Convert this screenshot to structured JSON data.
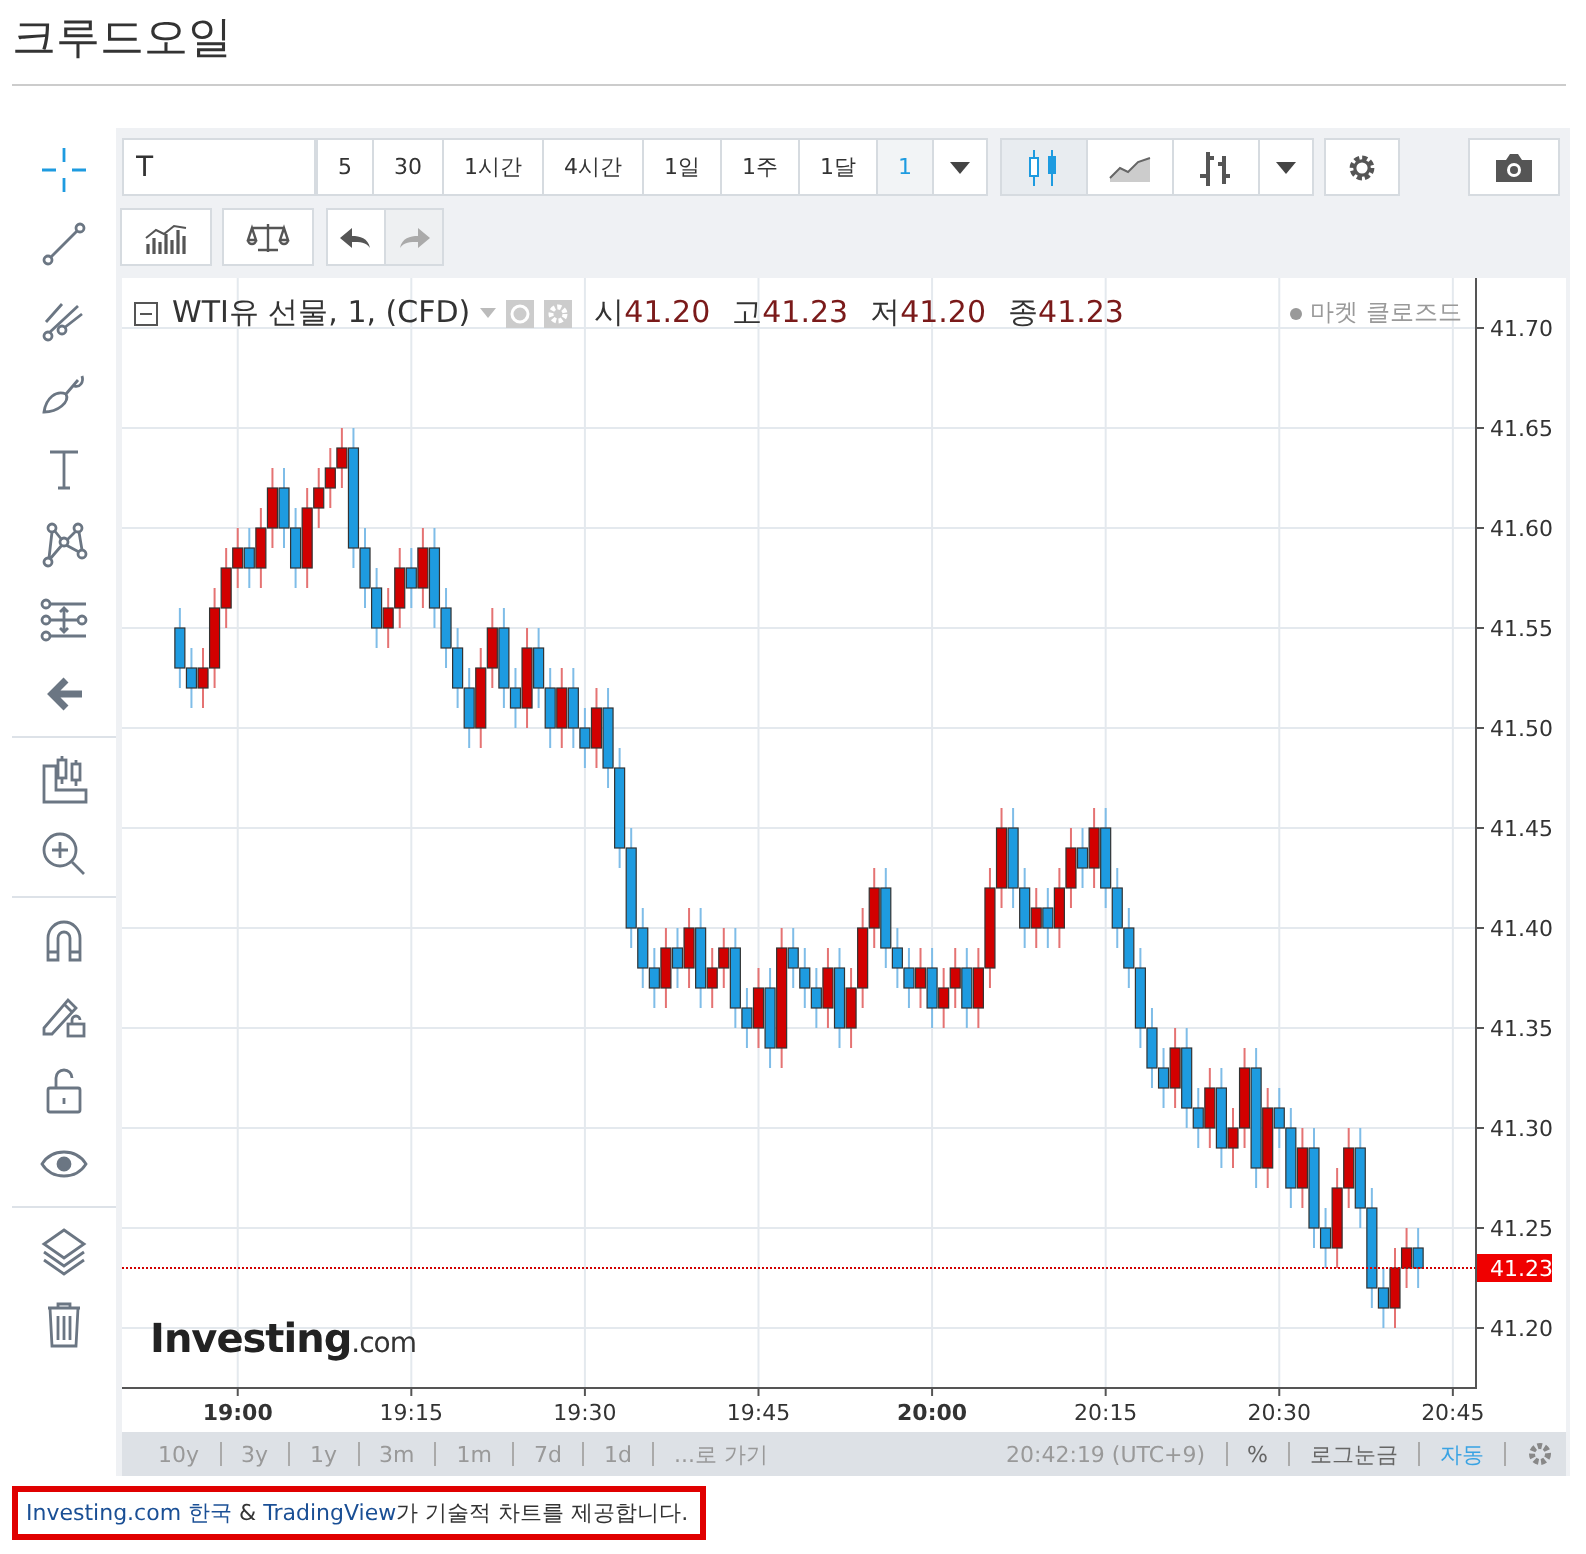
{
  "page_title": "크루드오일",
  "sidebar": {
    "groups": [
      [
        {
          "kind": "crosshair",
          "selected": true
        },
        {
          "kind": "trend-line",
          "selected": false
        },
        {
          "kind": "fork",
          "selected": false
        },
        {
          "kind": "brush",
          "selected": false
        },
        {
          "kind": "text",
          "selected": false
        },
        {
          "kind": "pattern",
          "selected": false
        },
        {
          "kind": "measure",
          "selected": false
        },
        {
          "kind": "back-arrow",
          "selected": false
        }
      ],
      [
        {
          "kind": "ruler",
          "selected": false
        },
        {
          "kind": "zoom",
          "selected": false
        }
      ],
      [
        {
          "kind": "magnet",
          "selected": false
        },
        {
          "kind": "pencil-lock",
          "selected": false
        },
        {
          "kind": "lock",
          "selected": false
        },
        {
          "kind": "eye",
          "selected": false
        }
      ],
      [
        {
          "kind": "layers",
          "selected": false
        },
        {
          "kind": "trash",
          "selected": false
        }
      ]
    ]
  },
  "toolbar": {
    "symbol": "T",
    "intervals": [
      {
        "label": "5",
        "selected": false
      },
      {
        "label": "30",
        "selected": false
      },
      {
        "label": "1시간",
        "selected": false
      },
      {
        "label": "4시간",
        "selected": false
      },
      {
        "label": "1일",
        "selected": false
      },
      {
        "label": "1주",
        "selected": false
      },
      {
        "label": "1달",
        "selected": false
      },
      {
        "label": "1",
        "selected": true
      }
    ],
    "chart_types": [
      {
        "kind": "candles",
        "selected": true
      },
      {
        "kind": "area",
        "selected": false
      },
      {
        "kind": "bars",
        "selected": false
      }
    ]
  },
  "legend": {
    "title": "WTI유 선물, 1, (CFD)",
    "values": [
      {
        "label": "시",
        "value": "41.20"
      },
      {
        "label": "고",
        "value": "41.23"
      },
      {
        "label": "저",
        "value": "41.20"
      },
      {
        "label": "종",
        "value": "41.23"
      }
    ],
    "status": "마켓 클로즈드"
  },
  "watermark_logo": {
    "main": "Investing",
    "suffix": ".com"
  },
  "chart_data": {
    "type": "candlestick",
    "grid": true,
    "ylim": [
      41.17,
      41.725
    ],
    "categories": [
      null,
      null,
      null,
      null,
      null,
      "19:00",
      null,
      null,
      null,
      null,
      null,
      null,
      null,
      null,
      null,
      null,
      null,
      null,
      null,
      null,
      "19:15",
      null,
      null,
      null,
      null,
      null,
      null,
      null,
      null,
      null,
      null,
      null,
      null,
      null,
      null,
      "19:30",
      null,
      null,
      null,
      null,
      null,
      null,
      null,
      null,
      null,
      null,
      null,
      null,
      null,
      null,
      "19:45",
      null,
      null,
      null,
      null,
      null,
      null,
      null,
      null,
      null,
      null,
      null,
      null,
      null,
      null,
      "20:00",
      null,
      null,
      null,
      null,
      null,
      null,
      null,
      null,
      null,
      null,
      null,
      null,
      null,
      null,
      "20:15",
      null,
      null,
      null,
      null,
      null,
      null,
      null,
      null,
      null,
      null,
      null,
      null,
      null,
      null,
      "20:30",
      null,
      null,
      null,
      null,
      null,
      null,
      null,
      null,
      null,
      null,
      null,
      null,
      null,
      null,
      "20:45"
    ],
    "yticks": [
      {
        "value": 41.2,
        "label": "41.20"
      },
      {
        "value": 41.25,
        "label": "41.25"
      },
      {
        "value": 41.3,
        "label": "41.30"
      },
      {
        "value": 41.35,
        "label": "41.35"
      },
      {
        "value": 41.4,
        "label": "41.40"
      },
      {
        "value": 41.45,
        "label": "41.45"
      },
      {
        "value": 41.5,
        "label": "41.50"
      },
      {
        "value": 41.55,
        "label": "41.55"
      },
      {
        "value": 41.6,
        "label": "41.60"
      },
      {
        "value": 41.65,
        "label": "41.65"
      },
      {
        "value": 41.7,
        "label": "41.70"
      }
    ],
    "ohlc": [
      [
        41.55,
        41.56,
        41.52,
        41.53
      ],
      [
        41.53,
        41.54,
        41.51,
        41.52
      ],
      [
        41.52,
        41.54,
        41.51,
        41.53
      ],
      [
        41.53,
        41.57,
        41.52,
        41.56
      ],
      [
        41.56,
        41.59,
        41.55,
        41.58
      ],
      [
        41.58,
        41.6,
        41.57,
        41.59
      ],
      [
        41.59,
        41.6,
        41.57,
        41.58
      ],
      [
        41.58,
        41.61,
        41.57,
        41.6
      ],
      [
        41.6,
        41.63,
        41.59,
        41.62
      ],
      [
        41.62,
        41.63,
        41.59,
        41.6
      ],
      [
        41.6,
        41.61,
        41.57,
        41.58
      ],
      [
        41.58,
        41.62,
        41.57,
        41.61
      ],
      [
        41.61,
        41.63,
        41.6,
        41.62
      ],
      [
        41.62,
        41.64,
        41.61,
        41.63
      ],
      [
        41.63,
        41.65,
        41.62,
        41.64
      ],
      [
        41.64,
        41.65,
        41.58,
        41.59
      ],
      [
        41.59,
        41.6,
        41.56,
        41.57
      ],
      [
        41.57,
        41.58,
        41.54,
        41.55
      ],
      [
        41.55,
        41.57,
        41.54,
        41.56
      ],
      [
        41.56,
        41.59,
        41.55,
        41.58
      ],
      [
        41.58,
        41.59,
        41.56,
        41.57
      ],
      [
        41.57,
        41.6,
        41.56,
        41.59
      ],
      [
        41.59,
        41.6,
        41.55,
        41.56
      ],
      [
        41.56,
        41.57,
        41.53,
        41.54
      ],
      [
        41.54,
        41.55,
        41.51,
        41.52
      ],
      [
        41.52,
        41.53,
        41.49,
        41.5
      ],
      [
        41.5,
        41.54,
        41.49,
        41.53
      ],
      [
        41.53,
        41.56,
        41.52,
        41.55
      ],
      [
        41.55,
        41.56,
        41.51,
        41.52
      ],
      [
        41.52,
        41.53,
        41.5,
        41.51
      ],
      [
        41.51,
        41.55,
        41.5,
        41.54
      ],
      [
        41.54,
        41.55,
        41.51,
        41.52
      ],
      [
        41.52,
        41.53,
        41.49,
        41.5
      ],
      [
        41.5,
        41.53,
        41.49,
        41.52
      ],
      [
        41.52,
        41.53,
        41.49,
        41.5
      ],
      [
        41.5,
        41.51,
        41.48,
        41.49
      ],
      [
        41.49,
        41.52,
        41.48,
        41.51
      ],
      [
        41.51,
        41.52,
        41.47,
        41.48
      ],
      [
        41.48,
        41.49,
        41.43,
        41.44
      ],
      [
        41.44,
        41.45,
        41.39,
        41.4
      ],
      [
        41.4,
        41.41,
        41.37,
        41.38
      ],
      [
        41.38,
        41.39,
        41.36,
        41.37
      ],
      [
        41.37,
        41.4,
        41.36,
        41.39
      ],
      [
        41.39,
        41.4,
        41.37,
        41.38
      ],
      [
        41.38,
        41.41,
        41.37,
        41.4
      ],
      [
        41.4,
        41.41,
        41.36,
        41.37
      ],
      [
        41.37,
        41.39,
        41.36,
        41.38
      ],
      [
        41.38,
        41.4,
        41.37,
        41.39
      ],
      [
        41.39,
        41.4,
        41.35,
        41.36
      ],
      [
        41.36,
        41.37,
        41.34,
        41.35
      ],
      [
        41.35,
        41.38,
        41.34,
        41.37
      ],
      [
        41.37,
        41.38,
        41.33,
        41.34
      ],
      [
        41.34,
        41.4,
        41.33,
        41.39
      ],
      [
        41.39,
        41.4,
        41.37,
        41.38
      ],
      [
        41.38,
        41.39,
        41.36,
        41.37
      ],
      [
        41.37,
        41.38,
        41.35,
        41.36
      ],
      [
        41.36,
        41.39,
        41.35,
        41.38
      ],
      [
        41.38,
        41.39,
        41.34,
        41.35
      ],
      [
        41.35,
        41.38,
        41.34,
        41.37
      ],
      [
        41.37,
        41.41,
        41.36,
        41.4
      ],
      [
        41.4,
        41.43,
        41.39,
        41.42
      ],
      [
        41.42,
        41.43,
        41.38,
        41.39
      ],
      [
        41.39,
        41.4,
        41.37,
        41.38
      ],
      [
        41.38,
        41.39,
        41.36,
        41.37
      ],
      [
        41.37,
        41.39,
        41.36,
        41.38
      ],
      [
        41.38,
        41.39,
        41.35,
        41.36
      ],
      [
        41.36,
        41.38,
        41.35,
        41.37
      ],
      [
        41.37,
        41.39,
        41.36,
        41.38
      ],
      [
        41.38,
        41.39,
        41.35,
        41.36
      ],
      [
        41.36,
        41.39,
        41.35,
        41.38
      ],
      [
        41.38,
        41.43,
        41.37,
        41.42
      ],
      [
        41.42,
        41.46,
        41.41,
        41.45
      ],
      [
        41.45,
        41.46,
        41.41,
        41.42
      ],
      [
        41.42,
        41.43,
        41.39,
        41.4
      ],
      [
        41.4,
        41.42,
        41.39,
        41.41
      ],
      [
        41.41,
        41.42,
        41.39,
        41.4
      ],
      [
        41.4,
        41.43,
        41.39,
        41.42
      ],
      [
        41.42,
        41.45,
        41.41,
        41.44
      ],
      [
        41.44,
        41.45,
        41.42,
        41.43
      ],
      [
        41.43,
        41.46,
        41.42,
        41.45
      ],
      [
        41.45,
        41.46,
        41.41,
        41.42
      ],
      [
        41.42,
        41.43,
        41.39,
        41.4
      ],
      [
        41.4,
        41.41,
        41.37,
        41.38
      ],
      [
        41.38,
        41.39,
        41.34,
        41.35
      ],
      [
        41.35,
        41.36,
        41.32,
        41.33
      ],
      [
        41.33,
        41.34,
        41.31,
        41.32
      ],
      [
        41.32,
        41.35,
        41.31,
        41.34
      ],
      [
        41.34,
        41.35,
        41.3,
        41.31
      ],
      [
        41.31,
        41.32,
        41.29,
        41.3
      ],
      [
        41.3,
        41.33,
        41.29,
        41.32
      ],
      [
        41.32,
        41.33,
        41.28,
        41.29
      ],
      [
        41.29,
        41.31,
        41.28,
        41.3
      ],
      [
        41.3,
        41.34,
        41.29,
        41.33
      ],
      [
        41.33,
        41.34,
        41.27,
        41.28
      ],
      [
        41.28,
        41.32,
        41.27,
        41.31
      ],
      [
        41.31,
        41.32,
        41.29,
        41.3
      ],
      [
        41.3,
        41.31,
        41.26,
        41.27
      ],
      [
        41.27,
        41.3,
        41.26,
        41.29
      ],
      [
        41.29,
        41.3,
        41.24,
        41.25
      ],
      [
        41.25,
        41.26,
        41.23,
        41.24
      ],
      [
        41.24,
        41.28,
        41.23,
        41.27
      ],
      [
        41.27,
        41.3,
        41.26,
        41.29
      ],
      [
        41.29,
        41.3,
        41.25,
        41.26
      ],
      [
        41.26,
        41.27,
        41.21,
        41.22
      ],
      [
        41.22,
        41.23,
        41.2,
        41.21
      ],
      [
        41.21,
        41.24,
        41.2,
        41.23
      ],
      [
        41.23,
        41.25,
        41.22,
        41.24
      ],
      [
        41.24,
        41.25,
        41.22,
        41.23
      ],
      null,
      null,
      null
    ],
    "ref_lines": [
      {
        "axis": "y",
        "value": 41.23,
        "label": "41.23",
        "color": "#d20000"
      }
    ]
  },
  "bottom_bar": {
    "ranges": [
      "10y",
      "3y",
      "1y",
      "3m",
      "1m",
      "7d",
      "1d"
    ],
    "goto": "...로 가기",
    "time": "20:42:19 (UTC+9)",
    "scales": [
      {
        "label": "%",
        "selected": false
      },
      {
        "label": "로그눈금",
        "selected": false
      },
      {
        "label": "자동",
        "selected": true
      }
    ]
  },
  "footer": {
    "link_1": "Investing.com 한국",
    "amp": "&",
    "link_2": "TradingView",
    "text": "가 기술적 차트를 제공합니다."
  }
}
